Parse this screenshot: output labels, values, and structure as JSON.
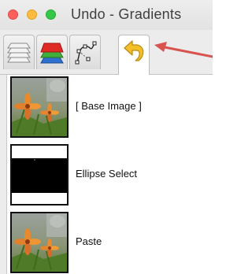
{
  "window": {
    "title": "Undo - Gradients"
  },
  "tabs": [
    {
      "icon": "layers-icon",
      "active": false
    },
    {
      "icon": "channels-icon",
      "active": false
    },
    {
      "icon": "paths-icon",
      "active": false
    },
    {
      "icon": "undo-history-icon",
      "active": true
    }
  ],
  "history": [
    {
      "label": "[ Base Image ]",
      "thumbnail": "flower-photo"
    },
    {
      "label": "Ellipse Select",
      "thumbnail": "black-selection-mask"
    },
    {
      "label": "Paste",
      "thumbnail": "flower-photo"
    }
  ],
  "colors": {
    "annotation_arrow": "#d9534f",
    "tab_bg": "#e6e6e6",
    "list_bg": "#ffffff"
  }
}
